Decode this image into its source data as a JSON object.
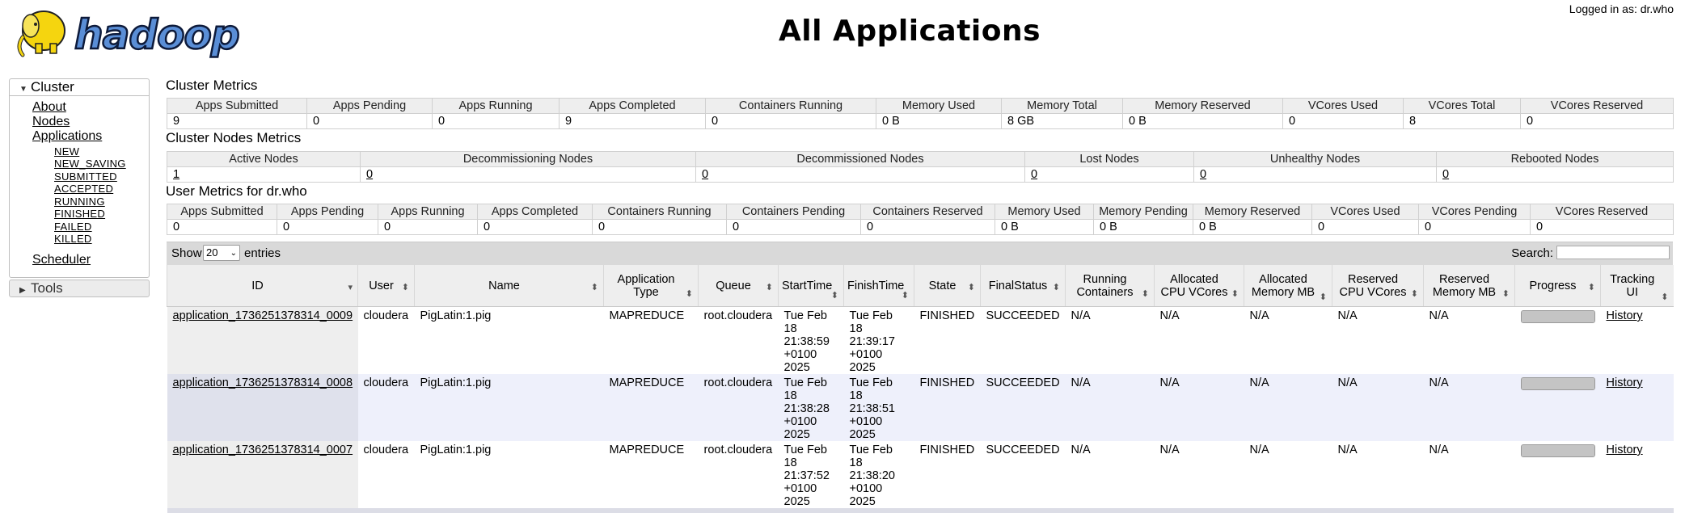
{
  "header": {
    "logo_text": "hadoop",
    "title": "All Applications",
    "logged_in": "Logged in as: dr.who"
  },
  "sidebar": {
    "cluster_label": "Cluster",
    "cluster_links": [
      "About",
      "Nodes",
      "Applications"
    ],
    "app_states": [
      "NEW",
      "NEW_SAVING",
      "SUBMITTED",
      "ACCEPTED",
      "RUNNING",
      "FINISHED",
      "FAILED",
      "KILLED"
    ],
    "scheduler": "Scheduler",
    "tools_label": "Tools"
  },
  "cluster_metrics": {
    "title": "Cluster Metrics",
    "headers": [
      "Apps Submitted",
      "Apps Pending",
      "Apps Running",
      "Apps Completed",
      "Containers Running",
      "Memory Used",
      "Memory Total",
      "Memory Reserved",
      "VCores Used",
      "VCores Total",
      "VCores Reserved"
    ],
    "values": [
      "9",
      "0",
      "0",
      "9",
      "0",
      "0 B",
      "8 GB",
      "0 B",
      "0",
      "8",
      "0"
    ]
  },
  "nodes_metrics": {
    "title": "Cluster Nodes Metrics",
    "headers": [
      "Active Nodes",
      "Decommissioning Nodes",
      "Decommissioned Nodes",
      "Lost Nodes",
      "Unhealthy Nodes",
      "Rebooted Nodes"
    ],
    "values": [
      "1",
      "0",
      "0",
      "0",
      "0",
      "0"
    ]
  },
  "user_metrics": {
    "title": "User Metrics for dr.who",
    "headers": [
      "Apps Submitted",
      "Apps Pending",
      "Apps Running",
      "Apps Completed",
      "Containers Running",
      "Containers Pending",
      "Containers Reserved",
      "Memory Used",
      "Memory Pending",
      "Memory Reserved",
      "VCores Used",
      "VCores Pending",
      "VCores Reserved"
    ],
    "values": [
      "0",
      "0",
      "0",
      "0",
      "0",
      "0",
      "0",
      "0 B",
      "0 B",
      "0 B",
      "0",
      "0",
      "0"
    ]
  },
  "apps_table": {
    "show_label": "Show",
    "entries_value": "20",
    "entries_label": "entries",
    "search_label": "Search:",
    "search_value": "",
    "headers": [
      "ID",
      "User",
      "Name",
      "Application Type",
      "Queue",
      "StartTime",
      "FinishTime",
      "State",
      "FinalStatus",
      "Running Containers",
      "Allocated CPU VCores",
      "Allocated Memory MB",
      "Reserved CPU VCores",
      "Reserved Memory MB",
      "Progress",
      "Tracking UI"
    ],
    "rows": [
      {
        "id": "application_1736251378314_0009",
        "user": "cloudera",
        "name": "PigLatin:1.pig",
        "type": "MAPREDUCE",
        "queue": "root.cloudera",
        "start": "Tue Feb 18 21:38:59 +0100 2025",
        "finish": "Tue Feb 18 21:39:17 +0100 2025",
        "state": "FINISHED",
        "final_status": "SUCCEEDED",
        "running_containers": "N/A",
        "alloc_cpu": "N/A",
        "alloc_mem": "N/A",
        "res_cpu": "N/A",
        "res_mem": "N/A",
        "progress": 1.0,
        "tracking": "History"
      },
      {
        "id": "application_1736251378314_0008",
        "user": "cloudera",
        "name": "PigLatin:1.pig",
        "type": "MAPREDUCE",
        "queue": "root.cloudera",
        "start": "Tue Feb 18 21:38:28 +0100 2025",
        "finish": "Tue Feb 18 21:38:51 +0100 2025",
        "state": "FINISHED",
        "final_status": "SUCCEEDED",
        "running_containers": "N/A",
        "alloc_cpu": "N/A",
        "alloc_mem": "N/A",
        "res_cpu": "N/A",
        "res_mem": "N/A",
        "progress": 1.0,
        "tracking": "History"
      },
      {
        "id": "application_1736251378314_0007",
        "user": "cloudera",
        "name": "PigLatin:1.pig",
        "type": "MAPREDUCE",
        "queue": "root.cloudera",
        "start": "Tue Feb 18 21:37:52 +0100 2025",
        "finish": "Tue Feb 18 21:38:20 +0100 2025",
        "state": "FINISHED",
        "final_status": "SUCCEEDED",
        "running_containers": "N/A",
        "alloc_cpu": "N/A",
        "alloc_mem": "N/A",
        "res_cpu": "N/A",
        "res_mem": "N/A",
        "progress": 1.0,
        "tracking": "History"
      }
    ]
  }
}
